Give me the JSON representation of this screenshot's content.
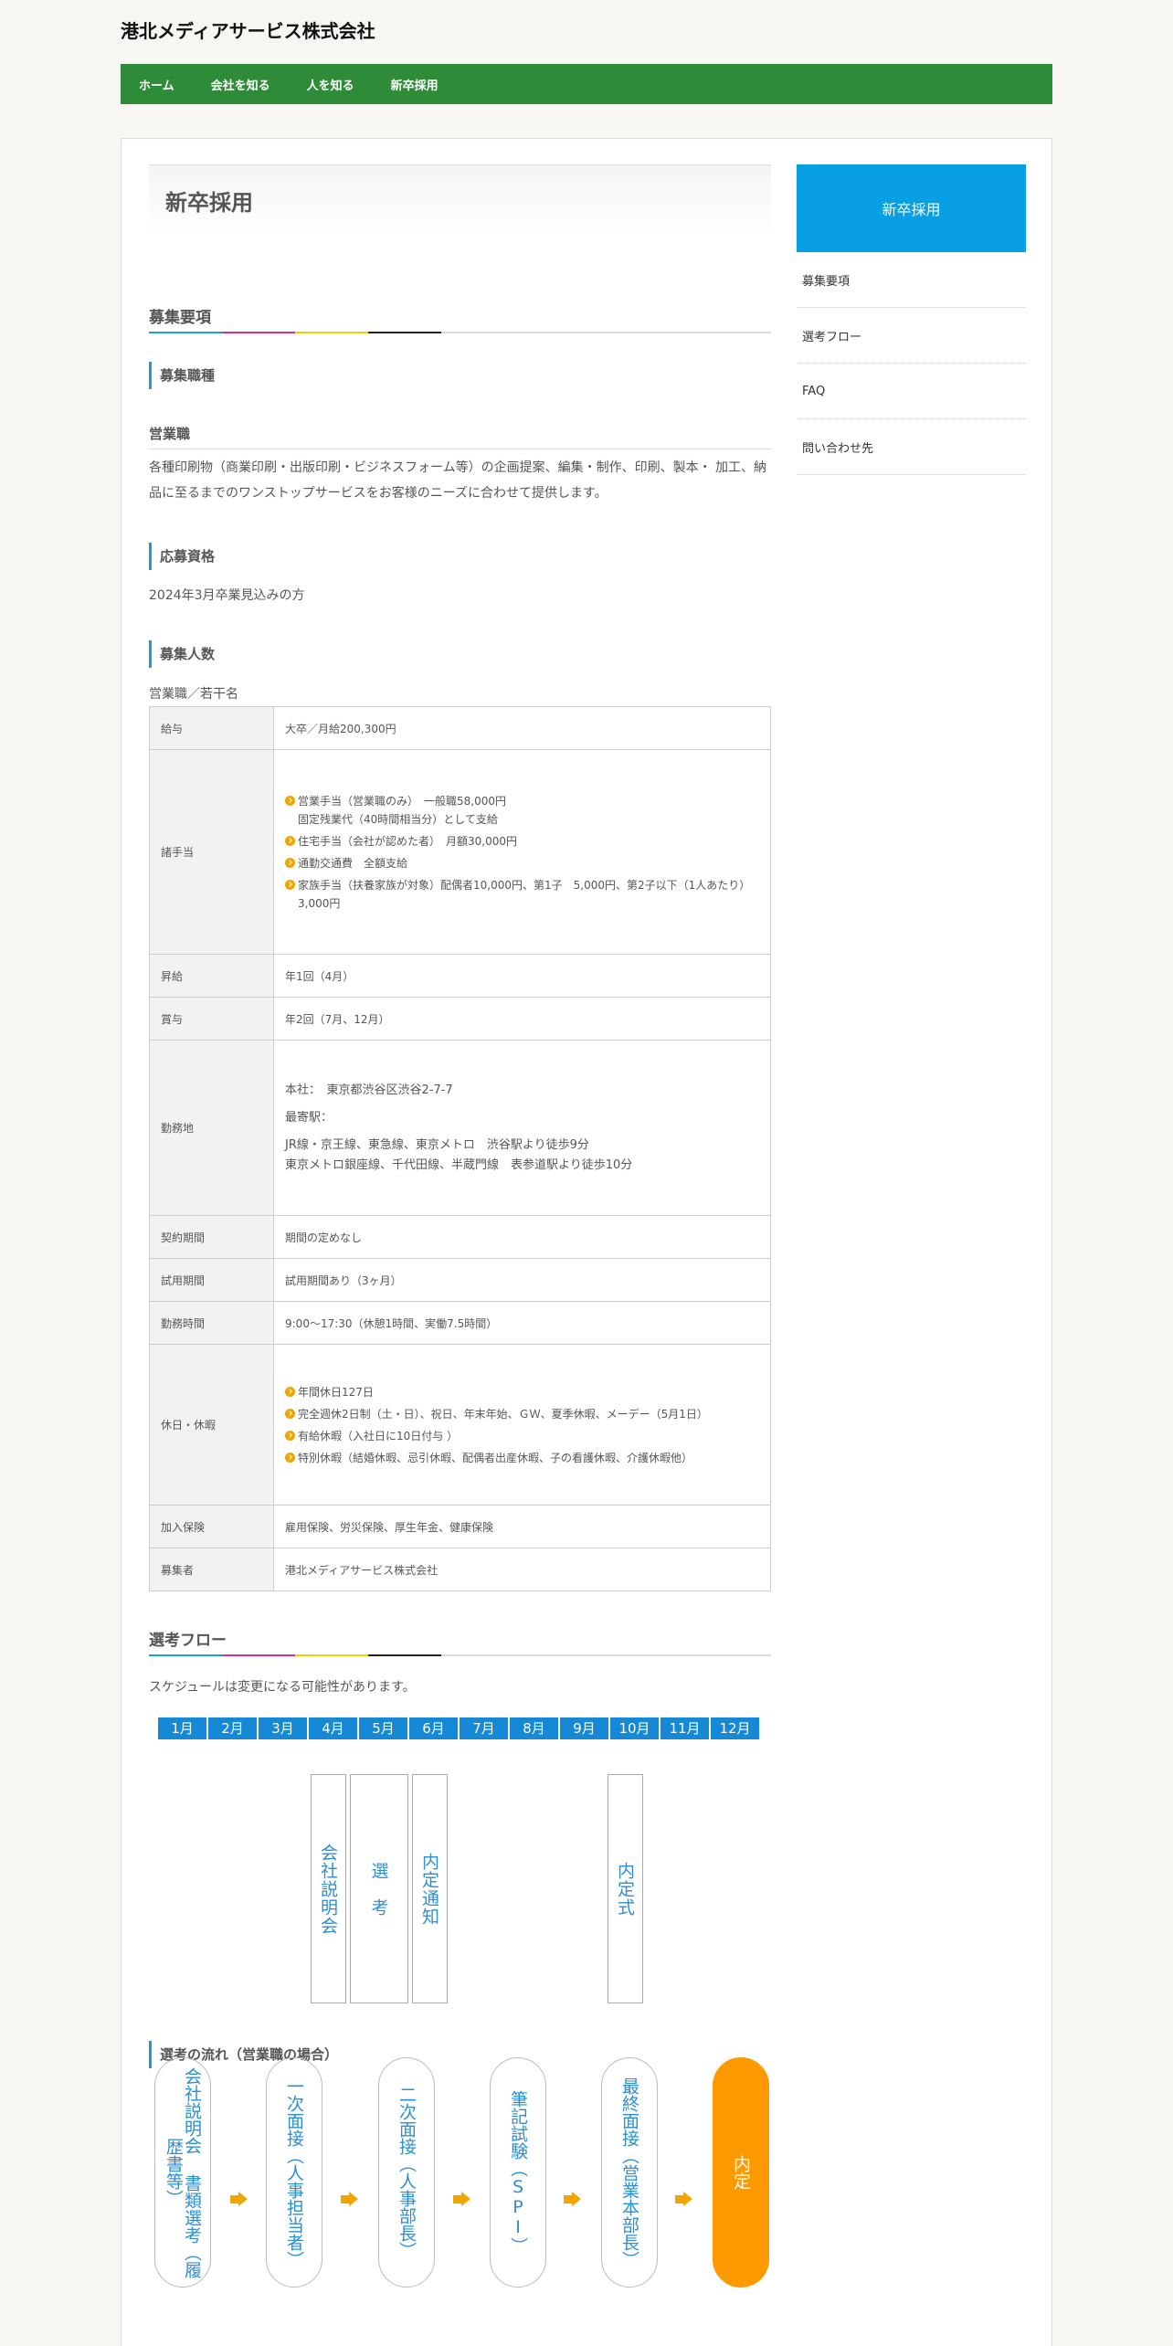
{
  "site": {
    "title": "港北メディアサービス株式会社"
  },
  "nav": [
    "ホーム",
    "会社を知る",
    "人を知る",
    "新卒採用"
  ],
  "page": {
    "title": "新卒採用"
  },
  "recruit": {
    "heading": "募集要項",
    "job_heading": "募集職種",
    "job_name": "営業職",
    "job_desc": "各種印刷物（商業印刷・出版印刷・ビジネスフォーム等）の企画提案、編集・制作、印刷、製本・ 加工、納品に至るまでのワンストップサービスをお客様のニーズに合わせて提供します。",
    "qual_heading": "応募資格",
    "qual_text": "2024年3月卒業見込みの方",
    "count_heading": "募集人数",
    "count_text": "営業職／若干名"
  },
  "table": {
    "salary_label": "給与",
    "salary_value": "大卒／月給200,300円",
    "allowance_label": "諸手当",
    "allowance_items": [
      "営業手当（営業職のみ）　一般職58,000円",
      "固定残業代（40時間相当分）として支給",
      "住宅手当（会社が認めた者）　月額30,000円",
      "通勤交通費　全額支給",
      "家族手当（扶養家族が対象）配偶者10,000円、第1子　5,000円、第2子以下（1人あたり）3,000円"
    ],
    "raise_label": "昇給",
    "raise_value": "年1回（4月）",
    "bonus_label": "賞与",
    "bonus_value": "年2回（7月、12月）",
    "location_label": "勤務地",
    "location_lines": [
      "本社：　東京都渋谷区渋谷2-7-7",
      "最寄駅：",
      "JR線・京王線、東急線、東京メトロ　渋谷駅より徒歩9分",
      "東京メトロ銀座線、千代田線、半蔵門線　表参道駅より徒歩10分"
    ],
    "contract_label": "契約期間",
    "contract_value": "期間の定めなし",
    "trial_label": "試用期間",
    "trial_value": "試用期間あり（3ヶ月）",
    "hours_label": "勤務時間",
    "hours_value": "9:00～17:30（休憩1時間、実働7.5時間）",
    "holiday_label": "休日・休暇",
    "holiday_items": [
      "年間休日127日",
      "完全週休2日制（土・日）、祝日、年末年始、ＧＷ、夏季休暇、メーデー（5月1日）",
      "有給休暇（入社日に10日付与 ）",
      "特別休暇（結婚休暇、忌引休暇、配偶者出産休暇、子の看護休暇、介護休暇他）"
    ],
    "insurance_label": "加入保険",
    "insurance_value": "雇用保険、労災保険、厚生年金、健康保険",
    "recruiter_label": "募集者",
    "recruiter_value": "港北メディアサービス株式会社"
  },
  "flow": {
    "heading": "選考フロー",
    "note": "スケジュールは変更になる可能性があります。",
    "months": [
      "1月",
      "2月",
      "3月",
      "4月",
      "5月",
      "6月",
      "7月",
      "8月",
      "9月",
      "10月",
      "11月",
      "12月"
    ],
    "events": [
      "会社説明会",
      "選　考",
      "内定通知",
      "内定式"
    ],
    "process_heading": "選考の流れ（営業職の場合）",
    "steps": [
      "会社説明会 書類選考（履歴書等）",
      "一次面接（人事担当者）",
      "二次面接（人事部長）",
      "筆記試験（SPI）",
      "最終面接（営業本部長）",
      "内定"
    ]
  },
  "sidebar": {
    "title": "新卒採用",
    "items": [
      "募集要項",
      "選考フロー",
      "FAQ",
      "問い合わせ先"
    ]
  },
  "colors": {
    "nav": "#2e8b37",
    "accent_blue": "#099fe4",
    "accent_orange": "#ff9900"
  }
}
